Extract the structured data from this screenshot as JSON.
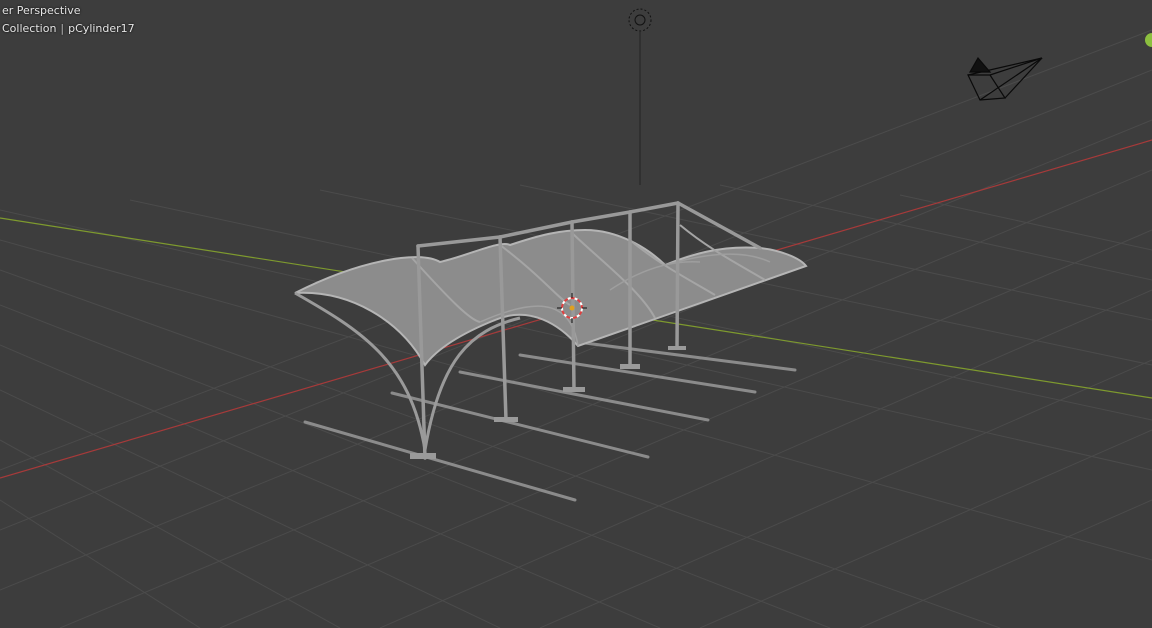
{
  "viewport": {
    "view_name": "User Perspective",
    "view_name_visible": "er Perspective",
    "collection": "Collection",
    "object": "pCylinder17"
  },
  "colors": {
    "background": "#3d3d3d",
    "grid": "#4a4a4a",
    "axis_x": "#a63a3a",
    "axis_y": "#7e9a2e",
    "mesh": "#8a8a8a",
    "mesh_edge": "#b0b0b0",
    "wire": "#000000",
    "cursor_red": "#e04040"
  },
  "icons": {
    "light": "light-icon",
    "camera": "camera-icon",
    "cursor": "3d-cursor-icon",
    "gizmo": "navigation-gizmo-y-icon"
  }
}
